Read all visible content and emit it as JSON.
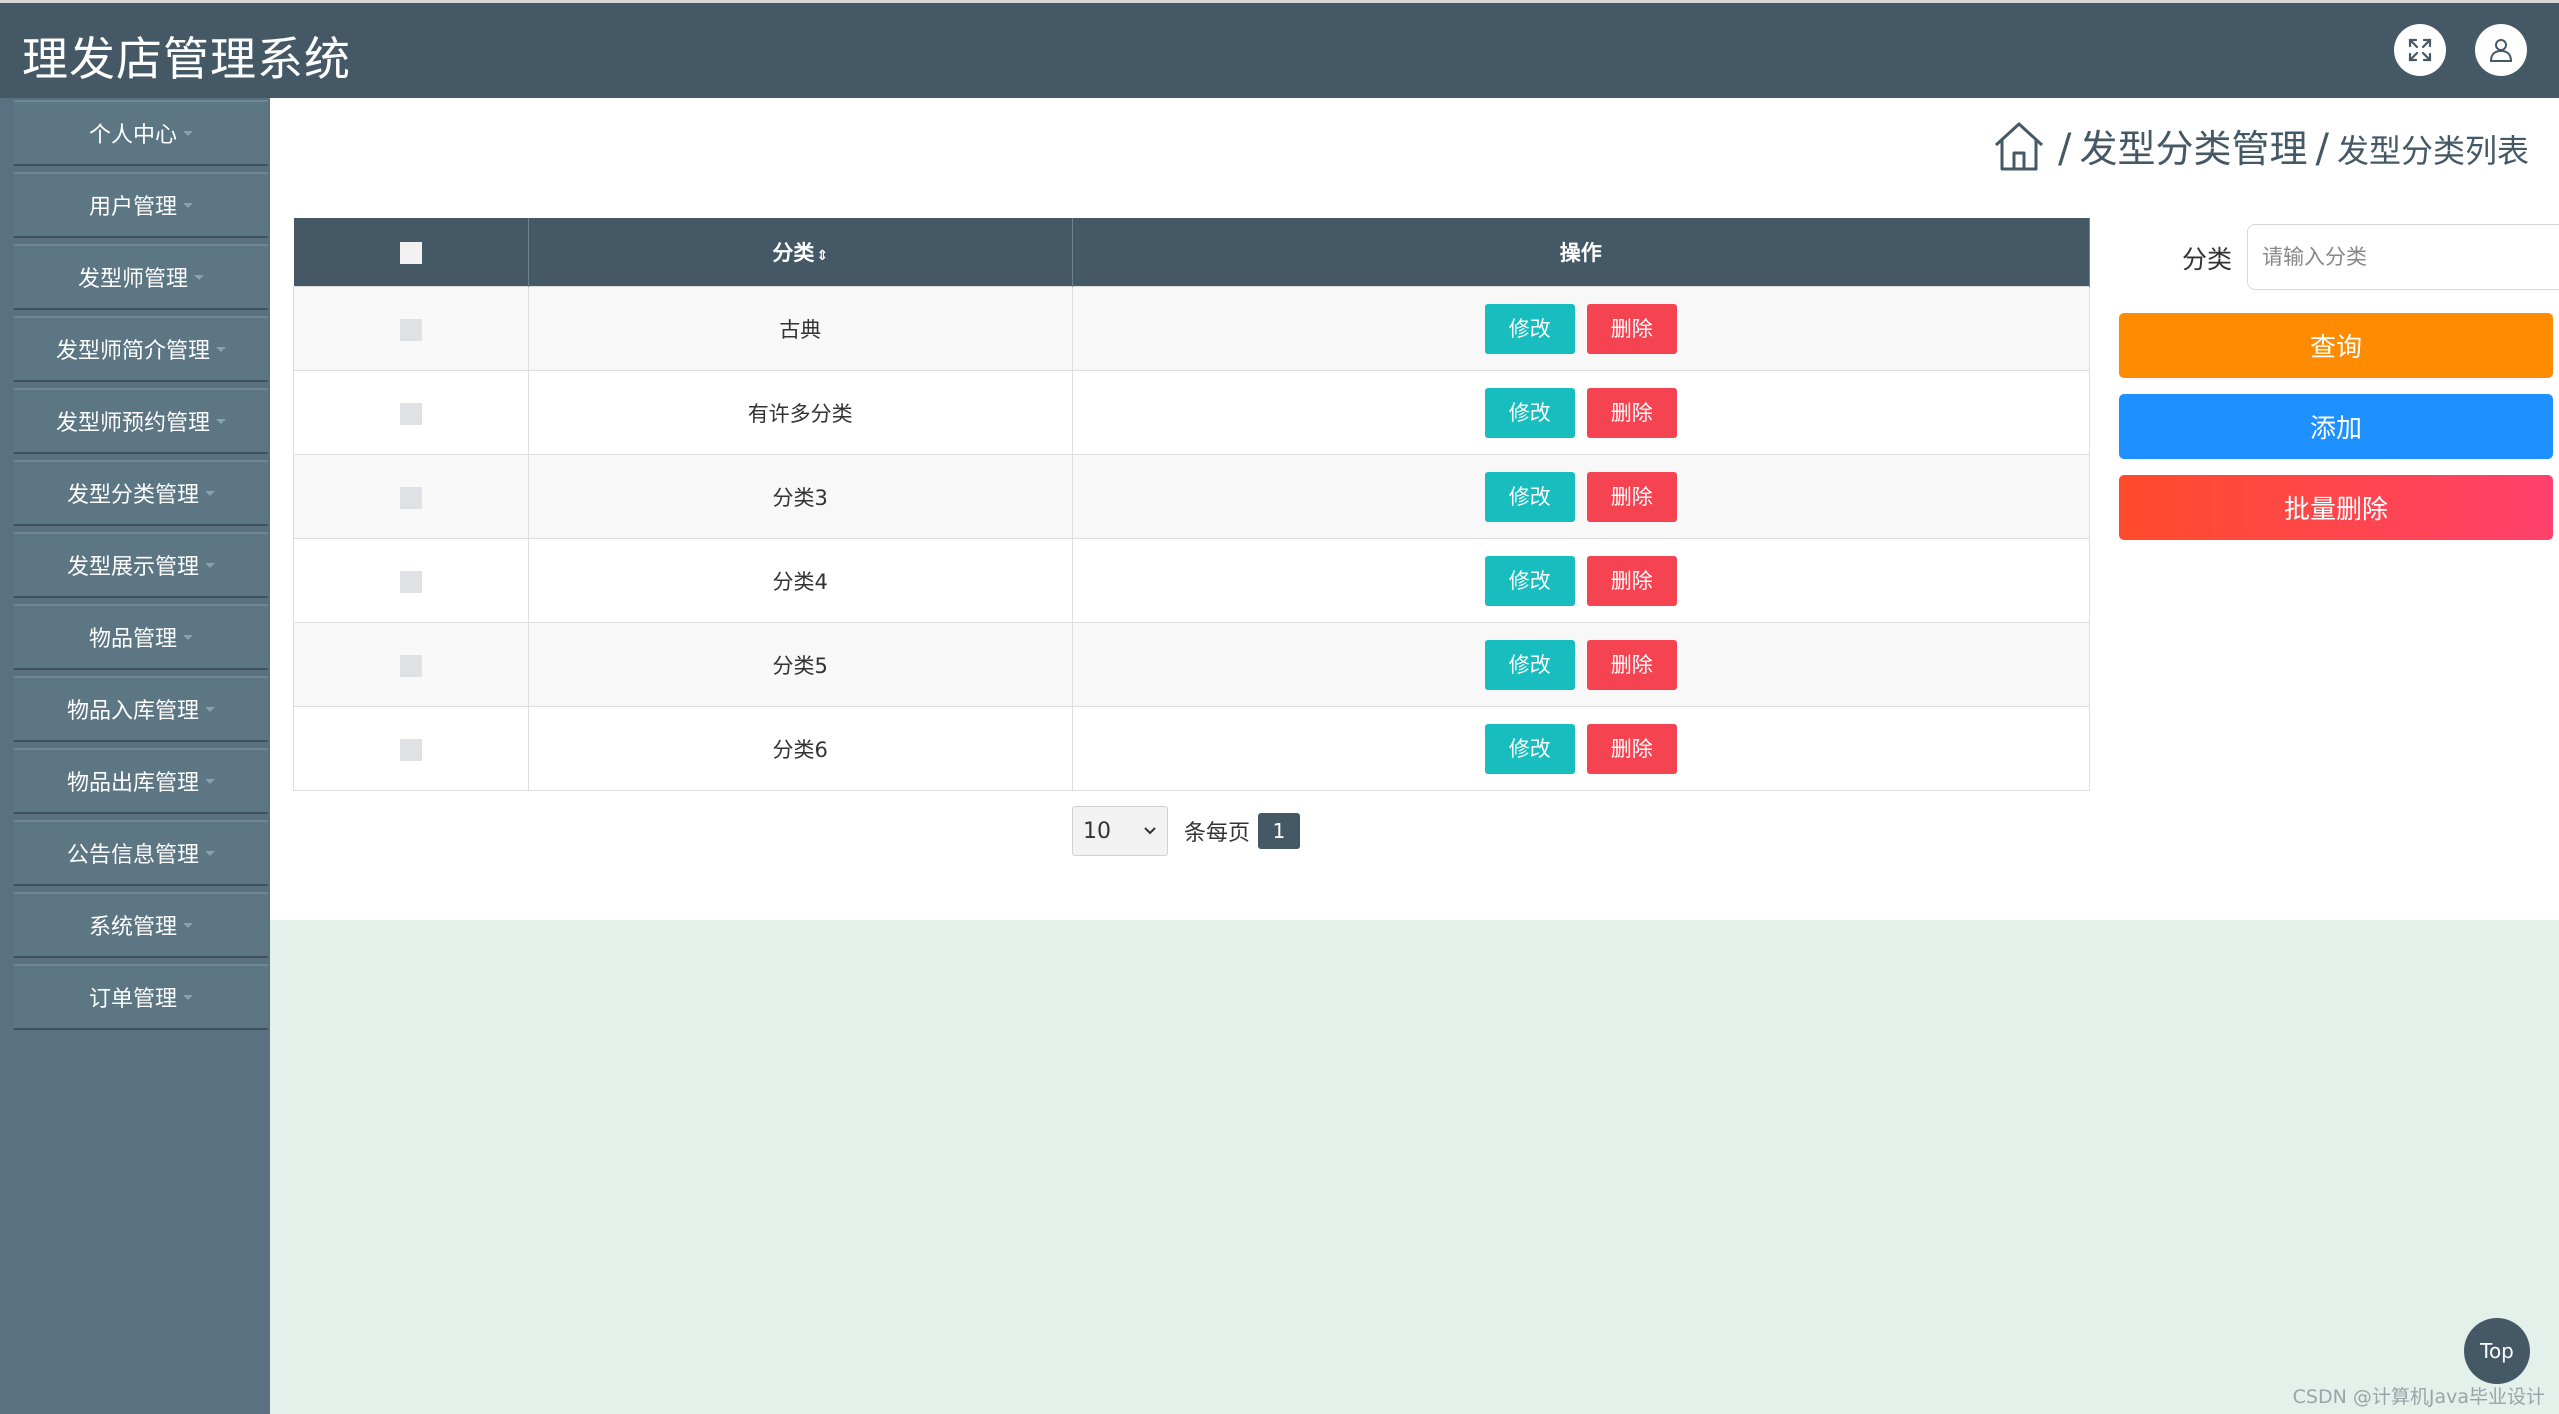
{
  "app": {
    "title": "理发店管理系统"
  },
  "header": {
    "icons": [
      "fullscreen-icon",
      "user-icon"
    ]
  },
  "sidebar": {
    "items": [
      {
        "label": "个人中心"
      },
      {
        "label": "用户管理"
      },
      {
        "label": "发型师管理"
      },
      {
        "label": "发型师简介管理"
      },
      {
        "label": "发型师预约管理"
      },
      {
        "label": "发型分类管理"
      },
      {
        "label": "发型展示管理"
      },
      {
        "label": "物品管理"
      },
      {
        "label": "物品入库管理"
      },
      {
        "label": "物品出库管理"
      },
      {
        "label": "公告信息管理"
      },
      {
        "label": "系统管理"
      },
      {
        "label": "订单管理"
      }
    ]
  },
  "breadcrumb": {
    "sep": "/",
    "section": "发型分类管理",
    "page": "发型分类列表"
  },
  "table": {
    "columns": [
      "分类",
      "操作"
    ],
    "sort_indicator": "⇕",
    "rows": [
      {
        "category": "古典"
      },
      {
        "category": "有许多分类"
      },
      {
        "category": "分类3"
      },
      {
        "category": "分类4"
      },
      {
        "category": "分类5"
      },
      {
        "category": "分类6"
      }
    ],
    "edit_label": "修改",
    "delete_label": "删除"
  },
  "pagination": {
    "page_size": "10",
    "per_page_label": "条每页",
    "current_page": "1"
  },
  "search": {
    "label": "分类",
    "placeholder": "请输入分类"
  },
  "actions": {
    "query_label": "查询",
    "add_label": "添加",
    "batch_delete_label": "批量删除"
  },
  "back_to_top": "Top",
  "watermark": "CSDN @计算机Java毕业设计",
  "colors": {
    "header": "#455866",
    "sidebar": "#597180",
    "edit": "#17bdbf",
    "delete": "#f64352",
    "query": "#ff8c00",
    "add": "#1e90ff",
    "batch_delete": "#ff416c"
  }
}
